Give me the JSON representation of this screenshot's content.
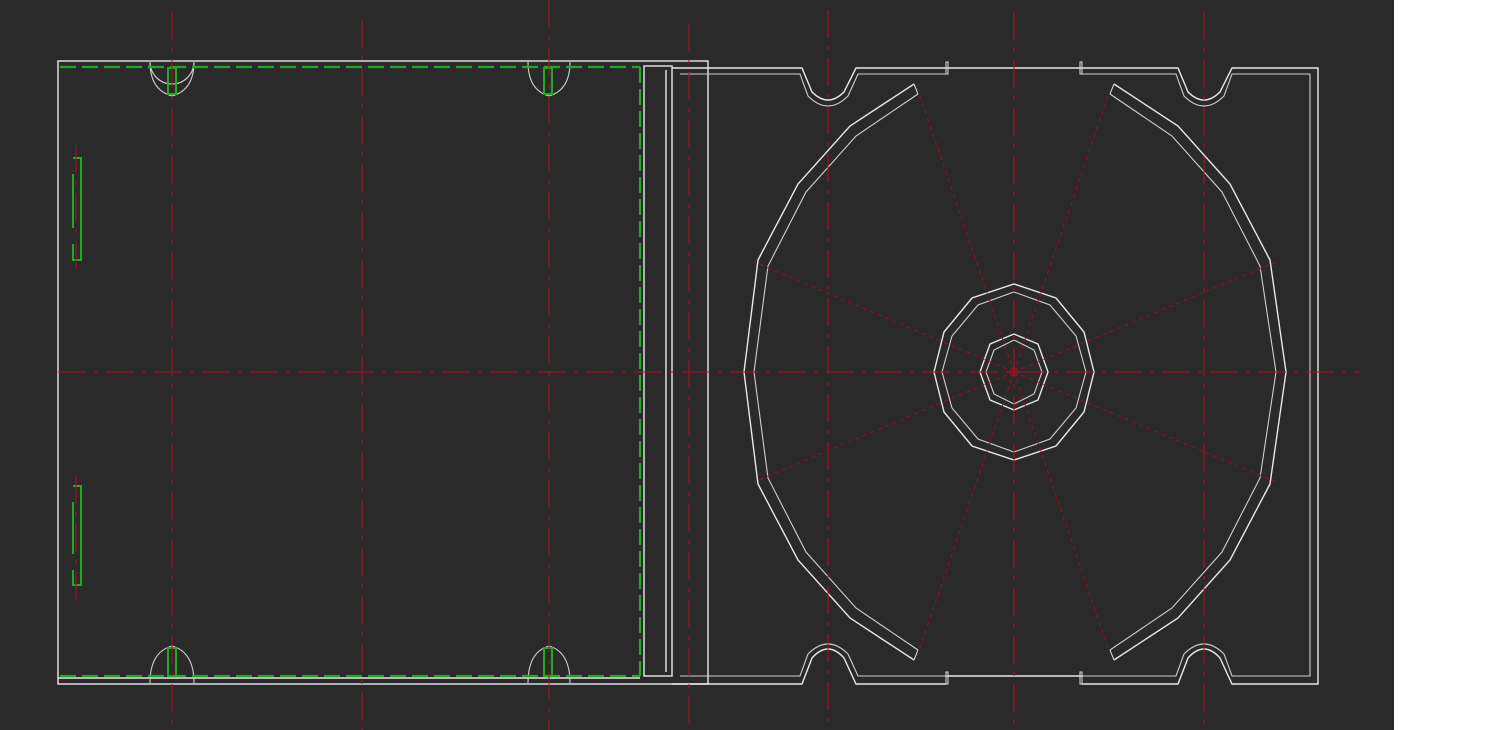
{
  "drawing": {
    "background": "#2a2a2a",
    "page_background": "#ffffff",
    "colors": {
      "outline": "#e8e8e8",
      "fold_line": "#20a820",
      "center_line": "#b01020"
    },
    "layers": [
      "outline",
      "fold_line",
      "center_line"
    ]
  }
}
